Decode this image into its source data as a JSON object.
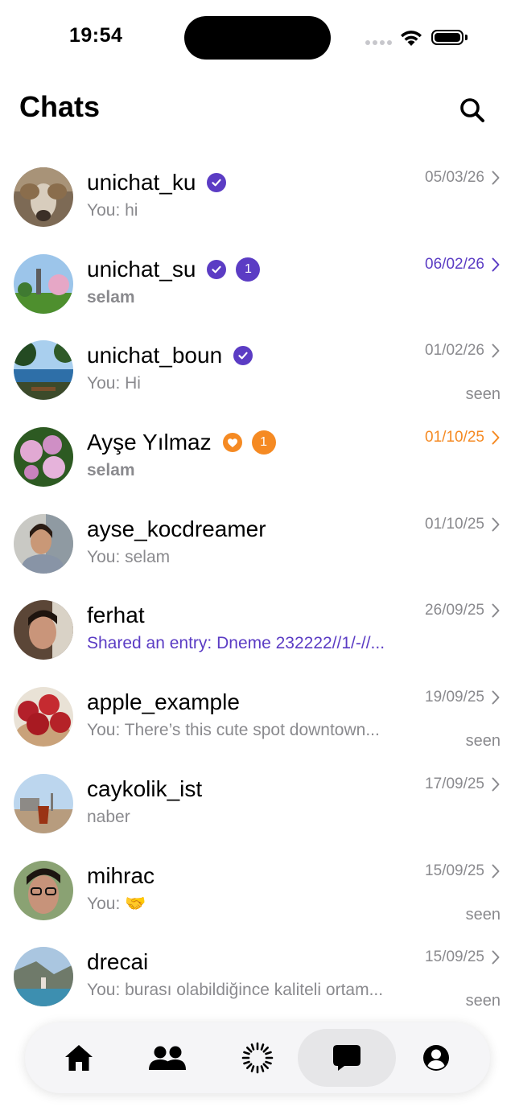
{
  "status_bar": {
    "time": "19:54"
  },
  "header": {
    "title": "Chats"
  },
  "colors": {
    "accent": "#5b3cc4",
    "heart_orange": "#f58a23",
    "muted": "#8a8a8e"
  },
  "chats": [
    {
      "name": "unichat_ku",
      "verified": true,
      "preview": "You: hi",
      "date": "05/03/26",
      "seen": "",
      "unread": ""
    },
    {
      "name": "unichat_su",
      "verified": true,
      "preview": "selam",
      "date": "06/02/26",
      "seen": "",
      "unread": "1"
    },
    {
      "name": "unichat_boun",
      "verified": true,
      "preview": "You: Hi",
      "date": "01/02/26",
      "seen": "seen",
      "unread": ""
    },
    {
      "name": "Ayşe Yılmaz",
      "heart": true,
      "preview": "selam",
      "date": "01/10/25",
      "seen": "",
      "unread": "1"
    },
    {
      "name": "ayse_kocdreamer",
      "preview": "You: selam",
      "date": "01/10/25",
      "seen": "",
      "unread": ""
    },
    {
      "name": "ferhat",
      "preview": "Shared an entry: Dneme 232222//1/-//...",
      "date": "26/09/25",
      "seen": "",
      "unread": ""
    },
    {
      "name": "apple_example",
      "preview": "You: There’s this cute spot downtown...",
      "date": "19/09/25",
      "seen": "seen",
      "unread": ""
    },
    {
      "name": "caykolik_ist",
      "preview": "naber",
      "date": "17/09/25",
      "seen": "",
      "unread": ""
    },
    {
      "name": "mihrac",
      "preview": "You: 🤝",
      "date": "15/09/25",
      "seen": "seen",
      "unread": ""
    },
    {
      "name": "drecai",
      "preview": "You: burası olabildiğince kaliteli ortam...",
      "date": "15/09/25",
      "seen": "seen",
      "unread": ""
    }
  ],
  "tab_bar": {
    "tabs": [
      {
        "icon": "home-icon",
        "label": "Home"
      },
      {
        "icon": "people-icon",
        "label": "Friends"
      },
      {
        "icon": "loading-icon",
        "label": "Feed"
      },
      {
        "icon": "chat-bubble-icon",
        "label": "Chats",
        "active": true
      },
      {
        "icon": "profile-icon",
        "label": "Profile"
      }
    ]
  }
}
